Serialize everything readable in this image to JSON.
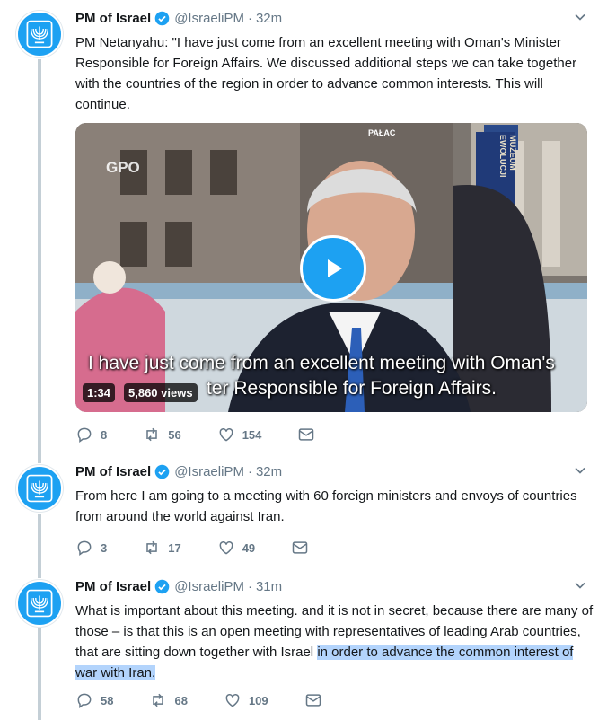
{
  "tweets": [
    {
      "name": "PM of Israel",
      "handle": "@IsraeliPM",
      "time": "32m",
      "text": "PM Netanyahu: \"I have just come from an excellent meeting with Oman's Minister Responsible for Foreign Affairs. We discussed additional steps we can take together with the countries of the region in order to advance common interests. This will continue.",
      "replies": "8",
      "retweets": "56",
      "likes": "154"
    },
    {
      "name": "PM of Israel",
      "handle": "@IsraeliPM",
      "time": "32m",
      "text": "From here I am going to a meeting with 60 foreign ministers and envoys of countries from around the world against Iran.",
      "replies": "3",
      "retweets": "17",
      "likes": "49"
    },
    {
      "name": "PM of Israel",
      "handle": "@IsraeliPM",
      "time": "31m",
      "text_plain": "What is important about this meeting. and it is not in secret, because there are many of those – is that this is an open meeting with representatives of leading Arab countries, that are sitting down together with Israel ",
      "text_highlight": "in order to advance the common interest of war with Iran.",
      "replies": "58",
      "retweets": "68",
      "likes": "109"
    }
  ],
  "video": {
    "subtitle_line1": "I have just come from an excellent meeting with Oman's",
    "subtitle_line2": "ter Responsible for Foreign Affairs.",
    "duration": "1:34",
    "views": "5,860 views",
    "watermark": "GPO",
    "sign_top": "PAŁAC",
    "sign_side": "MUZEUM EWOLUCJI"
  },
  "colors": {
    "accent": "#1da1f2",
    "highlight": "#b3d4fc",
    "muted": "#657786",
    "thread": "#c4cfd6"
  }
}
